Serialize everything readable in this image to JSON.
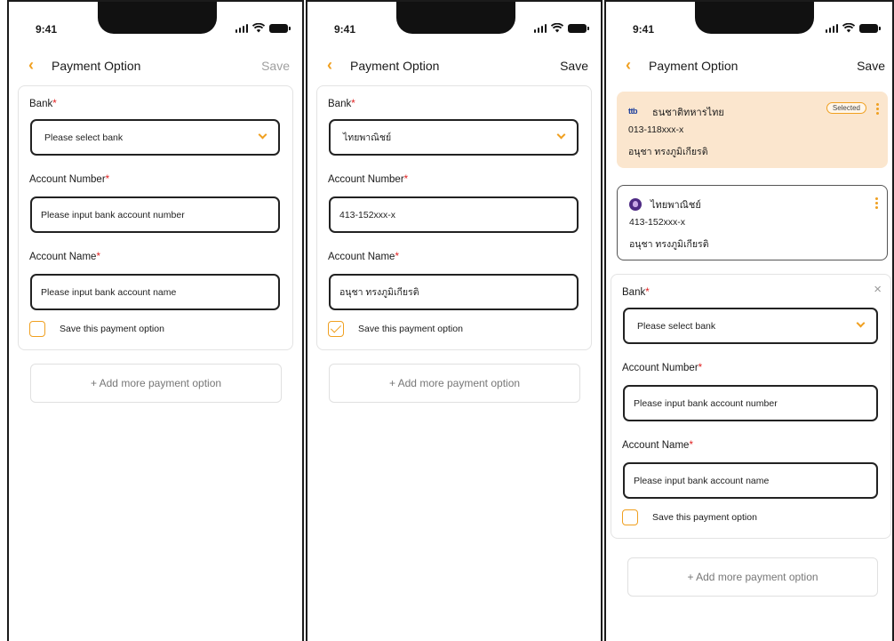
{
  "status_bar": {
    "time": "9:41"
  },
  "header": {
    "title": "Payment Option",
    "save_label": "Save"
  },
  "form": {
    "bank_label": "Bank",
    "account_number_label": "Account Number",
    "account_name_label": "Account Name",
    "required_mark": "*",
    "bank_placeholder": "Please select bank",
    "account_number_placeholder": "Please input bank account number",
    "account_name_placeholder": "Please input bank account name",
    "save_option_label": "Save this payment option"
  },
  "add_more_label": "+ Add more payment option",
  "screen2": {
    "bank_value": "ไทยพาณิชย์",
    "account_number_value": "413-152xxx-x",
    "account_name_value": "อนุชา ทรงภูมิเกียรติ",
    "save_checked": true
  },
  "screen3": {
    "saved_options": [
      {
        "logo_text": "ttb",
        "bank_name": "ธนชาติทหารไทย",
        "account_number": "013-118xxx-x",
        "account_name": "อนุชา ทรงภูมิเกียรติ",
        "selected": true,
        "badge": "Selected"
      },
      {
        "bank_name": "ไทยพาณิชย์",
        "account_number": "413-152xxx-x",
        "account_name": "อนุชา ทรงภูมิเกียรติ",
        "selected": false
      }
    ],
    "close_glyph": "×"
  },
  "colors": {
    "accent": "#f0a020",
    "required": "#e02020",
    "selected_bg": "#fbe6ce"
  },
  "icons": {
    "back": "chevron-left-icon",
    "dropdown": "chevron-down-icon",
    "menu": "kebab-menu-icon",
    "close": "close-icon"
  }
}
